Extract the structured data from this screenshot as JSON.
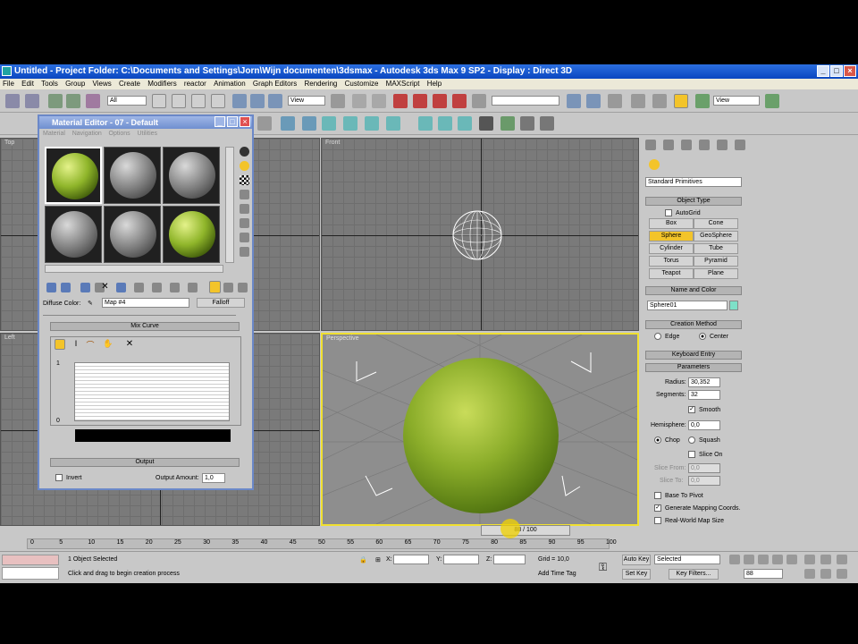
{
  "window": {
    "title": "Untitled    - Project Folder: C:\\Documents and Settings\\Jorn\\Wijn documenten\\3dsmax    - Autodesk 3ds Max 9 SP2    - Display : Direct 3D"
  },
  "menu": [
    "File",
    "Edit",
    "Tools",
    "Group",
    "Views",
    "Create",
    "Modifiers",
    "reactor",
    "Animation",
    "Graph Editors",
    "Rendering",
    "Customize",
    "MAXScript",
    "Help"
  ],
  "toolbar": {
    "selection_filter": "All",
    "ref_coord": "View",
    "ref_coord2": "View"
  },
  "viewports": {
    "top": "Top",
    "front": "Front",
    "left": "Left",
    "perspective": "Perspective"
  },
  "material_editor": {
    "title": "Material Editor - 07 - Default",
    "menu": [
      "Material",
      "Navigation",
      "Options",
      "Utilities"
    ],
    "diffuse_label": "Diffuse Color:",
    "map_name": "Map #4",
    "falloff_label": "Falloff",
    "mix_curve_label": "Mix Curve",
    "curve_top": "1",
    "curve_bottom": "0",
    "output_label": "Output",
    "invert_label": "Invert",
    "output_amount_label": "Output Amount:",
    "output_amount_value": "1,0"
  },
  "command_panel": {
    "dropdown": "Standard Primitives",
    "object_type": "Object Type",
    "autogrid": "AutoGrid",
    "buttons": [
      "Box",
      "Cone",
      "Sphere",
      "GeoSphere",
      "Cylinder",
      "Tube",
      "Torus",
      "Pyramid",
      "Teapot",
      "Plane"
    ],
    "name_and_color": "Name and Color",
    "object_name": "Sphere01",
    "creation_method": "Creation Method",
    "edge": "Edge",
    "center": "Center",
    "keyboard_entry": "Keyboard Entry",
    "parameters": "Parameters",
    "radius_label": "Radius:",
    "radius_value": "30,352",
    "segments_label": "Segments:",
    "segments_value": "32",
    "smooth": "Smooth",
    "hemisphere_label": "Hemisphere:",
    "hemisphere_value": "0,0",
    "chop": "Chop",
    "squash": "Squash",
    "slice_on": "Slice On",
    "slice_from_label": "Slice From:",
    "slice_from_value": "0,0",
    "slice_to_label": "Slice To:",
    "slice_to_value": "0,0",
    "base_to_pivot": "Base To Pivot",
    "gen_mapping": "Generate Mapping Coords.",
    "real_world": "Real-World Map Size"
  },
  "timeline": {
    "frame": "88 / 100",
    "ticks": [
      "0",
      "5",
      "10",
      "15",
      "20",
      "25",
      "30",
      "35",
      "40",
      "45",
      "50",
      "55",
      "60",
      "65",
      "70",
      "75",
      "80",
      "85",
      "90",
      "95",
      "100"
    ]
  },
  "status": {
    "selected": "1 Object Selected",
    "prompt": "Click and drag to begin creation process",
    "x": "X:",
    "y": "Y:",
    "z": "Z:",
    "grid": "Grid = 10,0",
    "add_time_tag": "Add Time Tag",
    "auto_key": "Auto Key",
    "selected_dropdown": "Selected",
    "set_key": "Set Key",
    "key_filters": "Key Filters...",
    "frame_field": "88"
  }
}
